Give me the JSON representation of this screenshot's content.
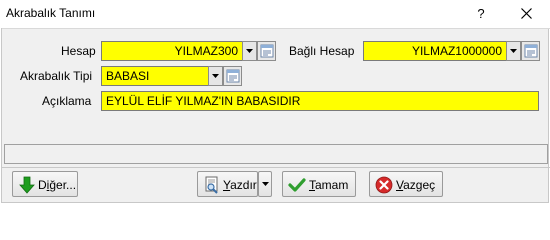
{
  "window": {
    "title": "Akrabalık Tanımı",
    "help_label": "?"
  },
  "form": {
    "hesap_label": "Hesap",
    "hesap_value": "YILMAZ300",
    "bagli_hesap_label": "Bağlı Hesap",
    "bagli_hesap_value": "YILMAZ1000000",
    "akrabalik_tipi_label": "Akrabalık Tipi",
    "akrabalik_tipi_value": "BABASI",
    "aciklama_label": "Açıklama",
    "aciklama_value": "EYLÜL ELİF YILMAZ'IN BABASIDIR"
  },
  "buttons": {
    "diger": {
      "pre": "D",
      "mnemonic": "i",
      "post": "ğer..."
    },
    "yazdir": {
      "pre": "",
      "mnemonic": "Y",
      "post": "azdır"
    },
    "tamam": {
      "pre": "",
      "mnemonic": "T",
      "post": "amam"
    },
    "vazgec": {
      "pre": "",
      "mnemonic": "V",
      "post": "azgeç"
    }
  },
  "colors": {
    "field_highlight": "#ffff00",
    "client_bg": "#f0f0f0",
    "arrow_green": "#1e9e1e",
    "check_green": "#2f9e2f",
    "cancel_red": "#d62a2a"
  },
  "icons": {
    "close": "close-icon",
    "lookup": "lookup-icon",
    "combo_arrow": "chevron-down-icon",
    "diger": "arrow-down-icon",
    "yazdir": "print-preview-icon",
    "tamam": "check-icon",
    "vazgec": "cancel-icon"
  }
}
